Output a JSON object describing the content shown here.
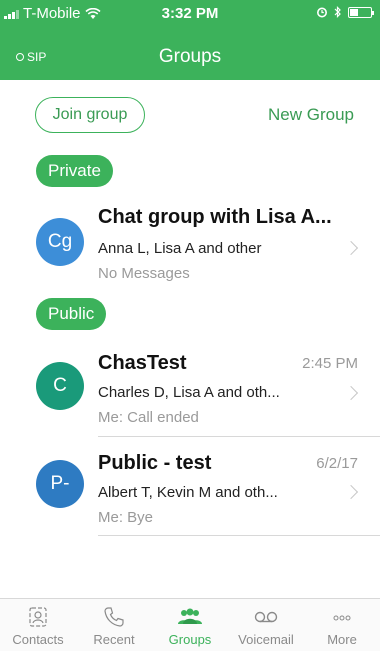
{
  "status_bar": {
    "carrier": "T-Mobile",
    "time": "3:32 PM"
  },
  "header": {
    "sip_label": "SIP",
    "title": "Groups"
  },
  "actions": {
    "join_label": "Join group",
    "new_group_label": "New Group"
  },
  "sections": [
    {
      "label": "Private",
      "groups": [
        {
          "avatar": "Cg",
          "avatar_color": "#3d8ed8",
          "name": "Chat group with Lisa A...",
          "time": "",
          "members": "Anna L, Lisa A and other",
          "last_message": "No Messages"
        }
      ]
    },
    {
      "label": "Public",
      "groups": [
        {
          "avatar": "C",
          "avatar_color": "#1a9a7a",
          "name": "ChasTest",
          "time": "2:45 PM",
          "members": "Charles D, Lisa A and oth...",
          "last_message": "Me: Call ended"
        },
        {
          "avatar": "P-",
          "avatar_color": "#2e7bc2",
          "name": "Public - test",
          "time": "6/2/17",
          "members": "Albert T, Kevin M and oth...",
          "last_message": "Me: Bye"
        }
      ]
    }
  ],
  "tabs": [
    {
      "label": "Contacts",
      "icon": "contacts-icon",
      "active": false
    },
    {
      "label": "Recent",
      "icon": "phone-icon",
      "active": false
    },
    {
      "label": "Groups",
      "icon": "groups-icon",
      "active": true
    },
    {
      "label": "Voicemail",
      "icon": "voicemail-icon",
      "active": false
    },
    {
      "label": "More",
      "icon": "more-icon",
      "active": false
    }
  ],
  "colors": {
    "brand_green": "#3cb25b",
    "link_green": "#3a9b54",
    "muted_gray": "#9a9a9a"
  }
}
